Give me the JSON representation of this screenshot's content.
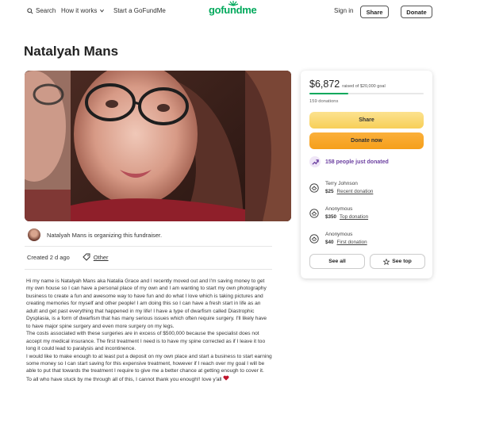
{
  "nav": {
    "search_label": "Search",
    "how_it_works_label": "How it works",
    "start_label": "Start a GoFundMe",
    "logo_text": "gofundme",
    "signin_label": "Sign in",
    "share_label": "Share",
    "donate_label": "Donate"
  },
  "page_title": "Natalyah Mans",
  "organizer": {
    "text": "Natalyah Mans is organizing this fundraiser."
  },
  "meta": {
    "created": "Created 2 d ago",
    "category": "Other"
  },
  "story": [
    "Hi my name is Natalyah Mans aka Natalia Grace and I recently moved out and I'm saving money to get my own house so I can have a personal place of my own and I am wanting to start my own photography business to create a fun and awesome way to have fun and do what I love which is taking pictures and creating memories for myself and other people! I am doing this so I can have a fresh start in life as an adult and get past everything that happened in my life! I have a type of dwarfism called Diastrophic Dysplasia, is a form of dwarfism that has many serious issues which often require surgery. I'll likely have to have major spine surgery and even more surgery on my legs.",
    "The costs associated with these surgeries are in excess of $500,000 because the specialist does not accept my medical insurance. The first treatment I need is to have my spine corrected as if I leave it too long it could lead to paralysis and incontinence.",
    "I would like to make enough to at least put a deposit on my own place and start a business to start earning some money so I can start saving for this expensive treatment, however if I reach over my goal I will be able to put that towards the treatment I require to give me a better chance at getting enough to cover it.",
    "To all who have stuck by me through all of this, I cannot thank you enough!! love y'all"
  ],
  "campaign": {
    "raised": "$6,872",
    "goal_text": "raised of $20,000 goal",
    "progress_fraction": 0.34,
    "donations": "159 donations",
    "share_label": "Share",
    "donate_label": "Donate now",
    "just_donated": "158 people just donated",
    "donors": [
      {
        "name": "Terry Johnson",
        "amount": "$25",
        "tag": "Recent donation"
      },
      {
        "name": "Anonymous",
        "amount": "$350",
        "tag": "Top donation"
      },
      {
        "name": "Anonymous",
        "amount": "$40",
        "tag": "First donation"
      }
    ],
    "see_all_label": "See all",
    "see_top_label": "See top"
  },
  "colors": {
    "brand": "#02a95c",
    "share_btn": "#f7cf58",
    "donate_btn": "#f59f1a",
    "trend": "#6b3fa0",
    "heart": "#c0152c"
  },
  "icons": [
    "search-icon",
    "chevron-down-icon",
    "tag-icon",
    "trend-up-icon",
    "donor-icon",
    "star-icon",
    "heart-icon"
  ]
}
